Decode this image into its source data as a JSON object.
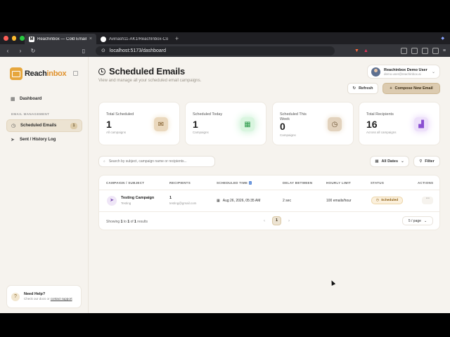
{
  "browser": {
    "tabs": [
      {
        "favicon": "M",
        "title": "Reachinbox — Cold Email Job"
      },
      {
        "favicon": "GH",
        "title": "Avinash11-AK1/ReachInbox-Cold-"
      }
    ],
    "url": "localhost:5173/dashboard"
  },
  "sidebar": {
    "logo_part1": "Reach",
    "logo_part2": "inbox",
    "dashboard_label": "Dashboard",
    "section_label": "EMAIL MANAGEMENT",
    "scheduled_label": "Scheduled Emails",
    "scheduled_badge": "1",
    "sent_label": "Sent / History Log",
    "help_title": "Need Help?",
    "help_text": "Check our docs or",
    "help_link": "contact support"
  },
  "header": {
    "title": "Scheduled Emails",
    "subtitle": "View and manage all your scheduled email campaigns.",
    "user_name": "Reachinbox Demo User",
    "user_email": "demo.user@reachinbox.ai",
    "refresh_label": "Refresh",
    "compose_label": "Compose New Email"
  },
  "stats": [
    {
      "label": "Total Scheduled",
      "value": "1",
      "sub": "All campaigns"
    },
    {
      "label": "Scheduled Today",
      "value": "1",
      "sub": "Campaigns"
    },
    {
      "label": "Scheduled This Week",
      "value": "0",
      "sub": "Campaigns"
    },
    {
      "label": "Total Recipients",
      "value": "16",
      "sub": "Across all campaigns"
    }
  ],
  "toolbar": {
    "search_placeholder": "Search by subject, campaign name or recipients...",
    "date_label": "All Dates",
    "filter_label": "Filter"
  },
  "table": {
    "headers": [
      "CAMPAIGN / SUBJECT",
      "RECIPIENTS",
      "SCHEDULED TIME",
      "DELAY BETWEEN",
      "HOURLY LIMIT",
      "STATUS",
      "ACTIONS"
    ],
    "rows": [
      {
        "campaign": "Testing Campaign",
        "subject": "Testing",
        "recipients": "1",
        "recipient_email": "testing@gmail.com",
        "scheduled": "Aug 26, 2026, 05:35 AM",
        "delay": "2 sec",
        "hourly": "100 emails/hour",
        "status": "Scheduled"
      }
    ],
    "footer_showing": "Showing",
    "footer_from": "1",
    "footer_to_word": "to",
    "footer_to": "1",
    "footer_of_word": "of",
    "footer_total": "1",
    "footer_results": "results",
    "current_page": "1",
    "per_page": "5 / page"
  },
  "colors": {
    "accent": "#dccbb0",
    "background": "#f6f3ee",
    "status_scheduled": "#fbf0dc"
  }
}
